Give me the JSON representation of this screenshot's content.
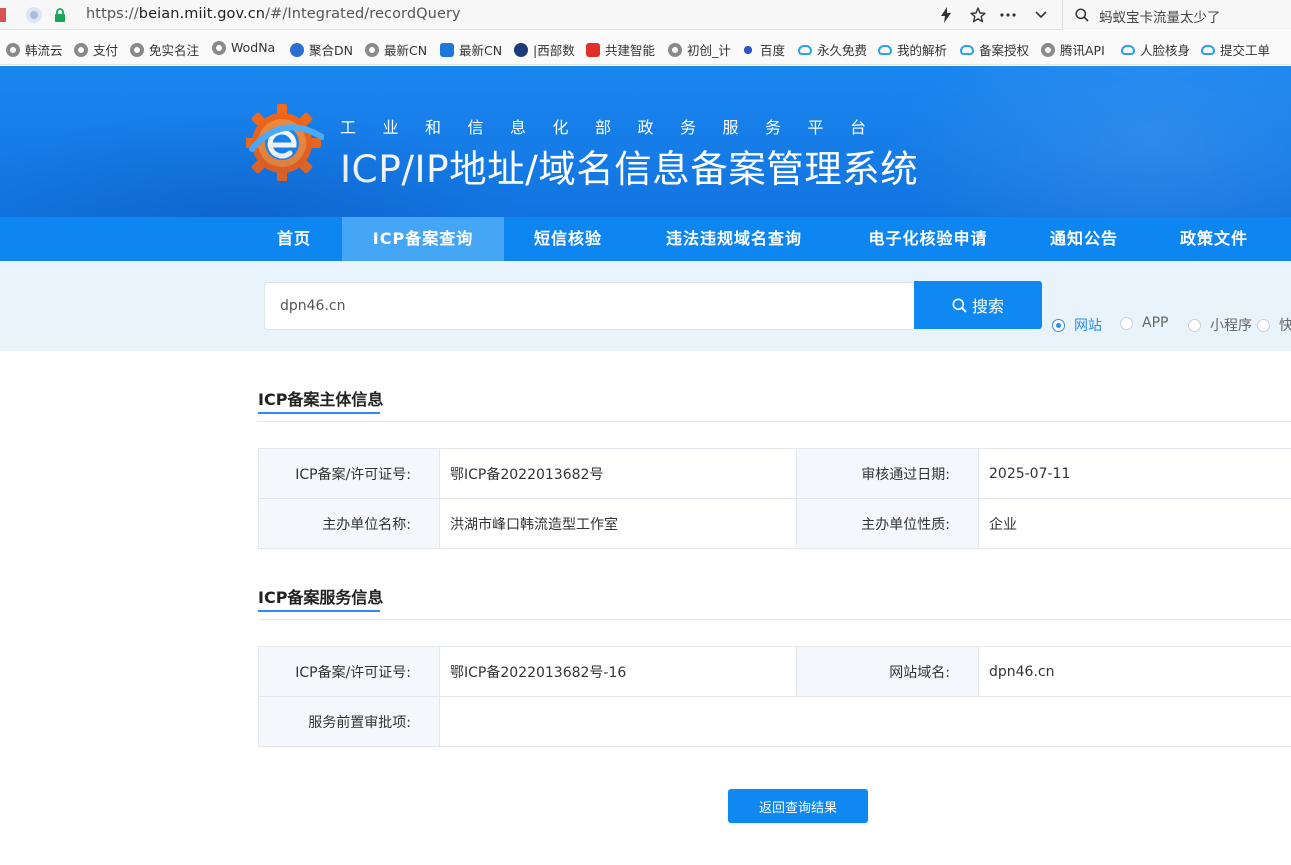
{
  "browser": {
    "url_prefix": "https://",
    "url_host": "beian.miit.gov.cn",
    "url_path": "/#/Integrated/recordQuery",
    "search_text": "蚂蚁宝卡流量太少了",
    "icons": {
      "site": "site-badge-icon",
      "lock": "lock-icon",
      "lightning": "lightning-icon",
      "star": "star-icon",
      "more": "more-icon",
      "dropdown": "chevron-down-icon",
      "search": "search-icon"
    }
  },
  "bookmarks": [
    {
      "label": "韩流云",
      "icon": "globe"
    },
    {
      "label": "支付",
      "icon": "globe"
    },
    {
      "label": "免实名注",
      "icon": "globe"
    },
    {
      "label": "WodNa",
      "icon": "globe"
    },
    {
      "label": "聚合DN",
      "icon": "blue"
    },
    {
      "label": "最新CN",
      "icon": "globe"
    },
    {
      "label": "最新CN",
      "icon": "shield"
    },
    {
      "label": "|西部数",
      "icon": "navy"
    },
    {
      "label": "共建智能",
      "icon": "red"
    },
    {
      "label": "初创_计",
      "icon": "globe"
    },
    {
      "label": "百度",
      "icon": "paw"
    },
    {
      "label": "永久免费",
      "icon": "cloud"
    },
    {
      "label": "我的解析",
      "icon": "cloud"
    },
    {
      "label": "备案授权",
      "icon": "cloud"
    },
    {
      "label": "腾讯API",
      "icon": "globe"
    },
    {
      "label": "人脸核身",
      "icon": "cloud"
    },
    {
      "label": "提交工单",
      "icon": "cloud"
    }
  ],
  "header": {
    "subtitle": "工业和信息化部政务服务平台",
    "title": "ICP/IP地址/域名信息备案管理系统",
    "emblem_icon": "gear-e-logo"
  },
  "nav": [
    {
      "label": "首页",
      "active": false
    },
    {
      "label": "ICP备案查询",
      "active": true
    },
    {
      "label": "短信核验",
      "active": false
    },
    {
      "label": "违法违规域名查询",
      "active": false
    },
    {
      "label": "电子化核验申请",
      "active": false
    },
    {
      "label": "通知公告",
      "active": false
    },
    {
      "label": "政策文件",
      "active": false
    }
  ],
  "search": {
    "value": "dpn46.cn",
    "button_label": "搜索",
    "options": [
      {
        "label": "网站",
        "checked": true
      },
      {
        "label": "APP",
        "checked": false
      },
      {
        "label": "小程序",
        "checked": false
      },
      {
        "label": "快",
        "checked": false
      }
    ]
  },
  "subject_info": {
    "title": "ICP备案主体信息",
    "rows": [
      [
        {
          "label": "ICP备案/许可证号:",
          "value": "鄂ICP备2022013682号"
        },
        {
          "label": "审核通过日期:",
          "value": "2025-07-11"
        }
      ],
      [
        {
          "label": "主办单位名称:",
          "value": "洪湖市峰口韩流造型工作室"
        },
        {
          "label": "主办单位性质:",
          "value": "企业"
        }
      ]
    ]
  },
  "service_info": {
    "title": "ICP备案服务信息",
    "rows": [
      [
        {
          "label": "ICP备案/许可证号:",
          "value": "鄂ICP备2022013682号-16"
        },
        {
          "label": "网站域名:",
          "value": "dpn46.cn"
        }
      ],
      [
        {
          "label": "服务前置审批项:",
          "value": ""
        }
      ]
    ]
  },
  "actions": {
    "back_label": "返回查询结果"
  },
  "colors": {
    "header_blue": "#1a86f0",
    "nav_blue": "#0d86f2",
    "nav_active": "#46a6f6",
    "accent": "#2d8cf0",
    "button": "#1088f2"
  }
}
